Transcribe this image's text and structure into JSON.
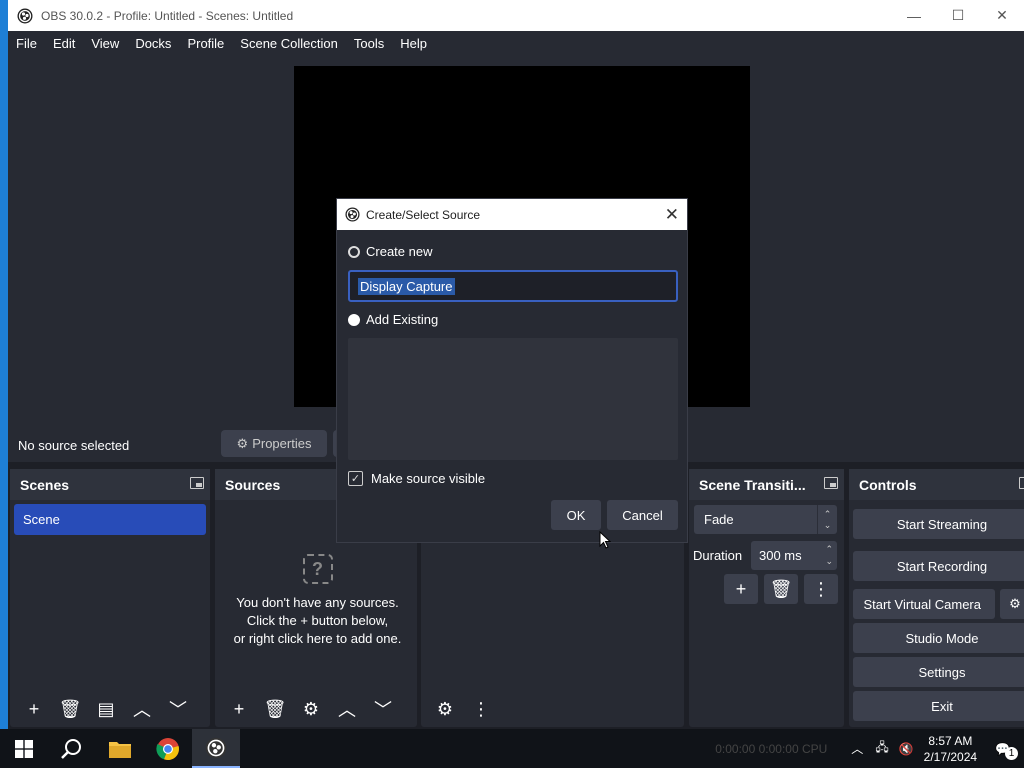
{
  "window": {
    "title": "OBS 30.0.2 - Profile: Untitled - Scenes: Untitled",
    "minimize": "—",
    "maximize": "☐",
    "close": "✕"
  },
  "menu": [
    "File",
    "Edit",
    "View",
    "Docks",
    "Profile",
    "Scene Collection",
    "Tools",
    "Help"
  ],
  "source_bar": {
    "status": "No source selected",
    "properties": "Properties"
  },
  "scenes": {
    "title": "Scenes",
    "items": [
      "Scene"
    ]
  },
  "sources": {
    "title": "Sources",
    "empty_line1": "You don't have any sources.",
    "empty_line2": "Click the + button below,",
    "empty_line3": "or right click here to add one."
  },
  "transitions": {
    "title": "Scene Transiti...",
    "selected": "Fade",
    "duration_label": "Duration",
    "duration_value": "300 ms"
  },
  "controls": {
    "title": "Controls",
    "start_streaming": "Start Streaming",
    "start_recording": "Start Recording",
    "start_virtual_camera": "Start Virtual Camera",
    "studio_mode": "Studio Mode",
    "settings": "Settings",
    "exit": "Exit"
  },
  "dialog": {
    "title": "Create/Select Source",
    "create_new": "Create new",
    "name_value": "Display Capture",
    "add_existing": "Add Existing",
    "make_visible": "Make source visible",
    "make_visible_checked": true,
    "ok": "OK",
    "cancel": "Cancel"
  },
  "taskbar": {
    "time": "8:57 AM",
    "date": "2/17/2024",
    "faded_status": "0:00:00     0:00:00     CPU",
    "notification_count": "1"
  },
  "colors": {
    "accent": "#284cb8",
    "dock_bg": "#272a33",
    "button_bg": "#3c404d"
  }
}
